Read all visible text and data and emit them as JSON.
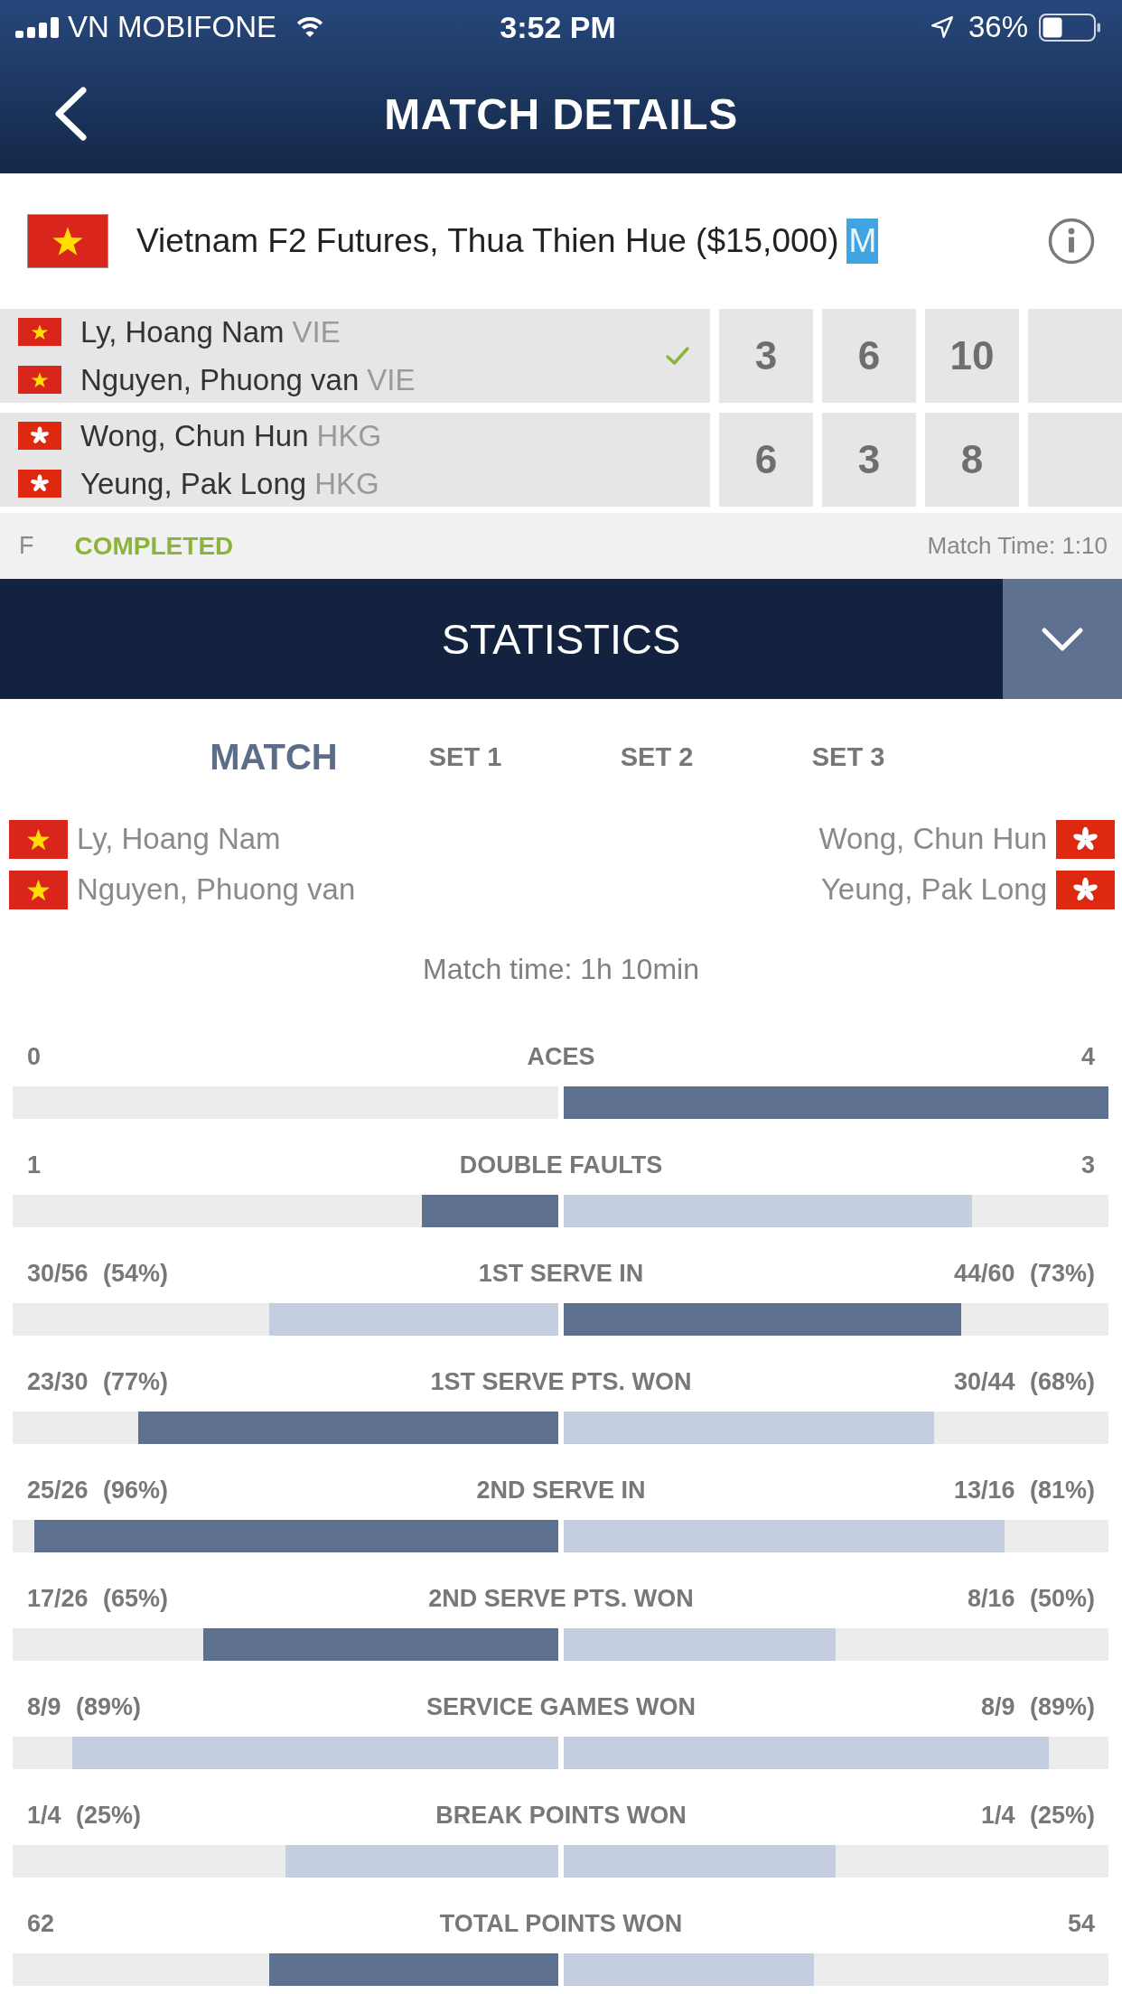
{
  "status_bar": {
    "carrier": "VN MOBIFONE",
    "time": "3:52 PM",
    "battery": "36%"
  },
  "header": {
    "title": "MATCH DETAILS"
  },
  "tournament": {
    "flag": {
      "kind": "vn"
    },
    "name": "Vietnam F2 Futures, Thua Thien Hue ($15,000)",
    "badge": "M"
  },
  "scoreboard": [
    {
      "winner": true,
      "players": [
        {
          "flag": {
            "kind": "vn"
          },
          "name": "Ly, Hoang Nam",
          "country": "VIE"
        },
        {
          "flag": {
            "kind": "vn"
          },
          "name": "Nguyen, Phuong van",
          "country": "VIE"
        }
      ],
      "scores": [
        "3",
        "6",
        "10"
      ]
    },
    {
      "winner": false,
      "players": [
        {
          "flag": {
            "kind": "hk"
          },
          "name": "Wong, Chun Hun",
          "country": "HKG"
        },
        {
          "flag": {
            "kind": "hk"
          },
          "name": "Yeung, Pak Long",
          "country": "HKG"
        }
      ],
      "scores": [
        "6",
        "3",
        "8"
      ]
    }
  ],
  "match_status": {
    "round": "F",
    "state": "COMPLETED",
    "match_time": "Match Time: 1:10"
  },
  "statistics": {
    "title": "STATISTICS",
    "tabs": [
      {
        "label": "MATCH",
        "selected": true
      },
      {
        "label": "SET 1",
        "selected": false
      },
      {
        "label": "SET 2",
        "selected": false
      },
      {
        "label": "SET 3",
        "selected": false
      }
    ],
    "teams": [
      [
        {
          "flag": {
            "kind": "vn"
          },
          "name": "Ly, Hoang Nam"
        },
        {
          "flag": {
            "kind": "vn"
          },
          "name": "Nguyen, Phuong van"
        }
      ],
      [
        {
          "flag": {
            "kind": "hk"
          },
          "name": "Wong, Chun Hun"
        },
        {
          "flag": {
            "kind": "hk"
          },
          "name": "Yeung, Pak Long"
        }
      ]
    ],
    "match_time": "Match time: 1h 10min",
    "rows": [
      {
        "label": "ACES",
        "left": {
          "value": "0"
        },
        "right": {
          "value": "4",
          "level": 1,
          "emphasized": true
        }
      },
      {
        "label": "DOUBLE FAULTS",
        "left": {
          "value": "1",
          "level": 0.25,
          "emphasized": true
        },
        "right": {
          "value": "3",
          "level": 0.75,
          "emphasized": false
        }
      },
      {
        "label": "1ST SERVE IN",
        "left": {
          "value": "30/56 (54%)",
          "level": 0.53,
          "emphasized": false
        },
        "right": {
          "value": "44/60 (73%)",
          "level": 0.73,
          "emphasized": true
        }
      },
      {
        "label": "1ST SERVE PTS. WON",
        "left": {
          "value": "23/30 (77%)",
          "level": 0.77,
          "emphasized": true
        },
        "right": {
          "value": "30/44 (68%)",
          "level": 0.68,
          "emphasized": false
        }
      },
      {
        "label": "2ND SERVE IN",
        "left": {
          "value": "25/26 (96%)",
          "level": 0.96,
          "emphasized": true
        },
        "right": {
          "value": "13/16 (81%)",
          "level": 0.81,
          "emphasized": false
        }
      },
      {
        "label": "2ND SERVE PTS. WON",
        "left": {
          "value": "17/26 (65%)",
          "level": 0.65,
          "emphasized": true
        },
        "right": {
          "value": "8/16 (50%)",
          "level": 0.5,
          "emphasized": false
        }
      },
      {
        "label": "SERVICE GAMES WON",
        "left": {
          "value": "8/9 (89%)",
          "level": 0.89,
          "emphasized": false
        },
        "right": {
          "value": "8/9 (89%)",
          "level": 0.89,
          "emphasized": false
        }
      },
      {
        "label": "BREAK POINTS WON",
        "left": {
          "value": "1/4 (25%)",
          "level": 0.5,
          "emphasized": false
        },
        "right": {
          "value": "1/4 (25%)",
          "level": 0.5,
          "emphasized": false
        }
      },
      {
        "label": "TOTAL POINTS WON",
        "left": {
          "value": "62",
          "level": 0.53,
          "emphasized": true
        },
        "right": {
          "value": "54",
          "level": 0.46,
          "emphasized": false
        }
      }
    ]
  }
}
